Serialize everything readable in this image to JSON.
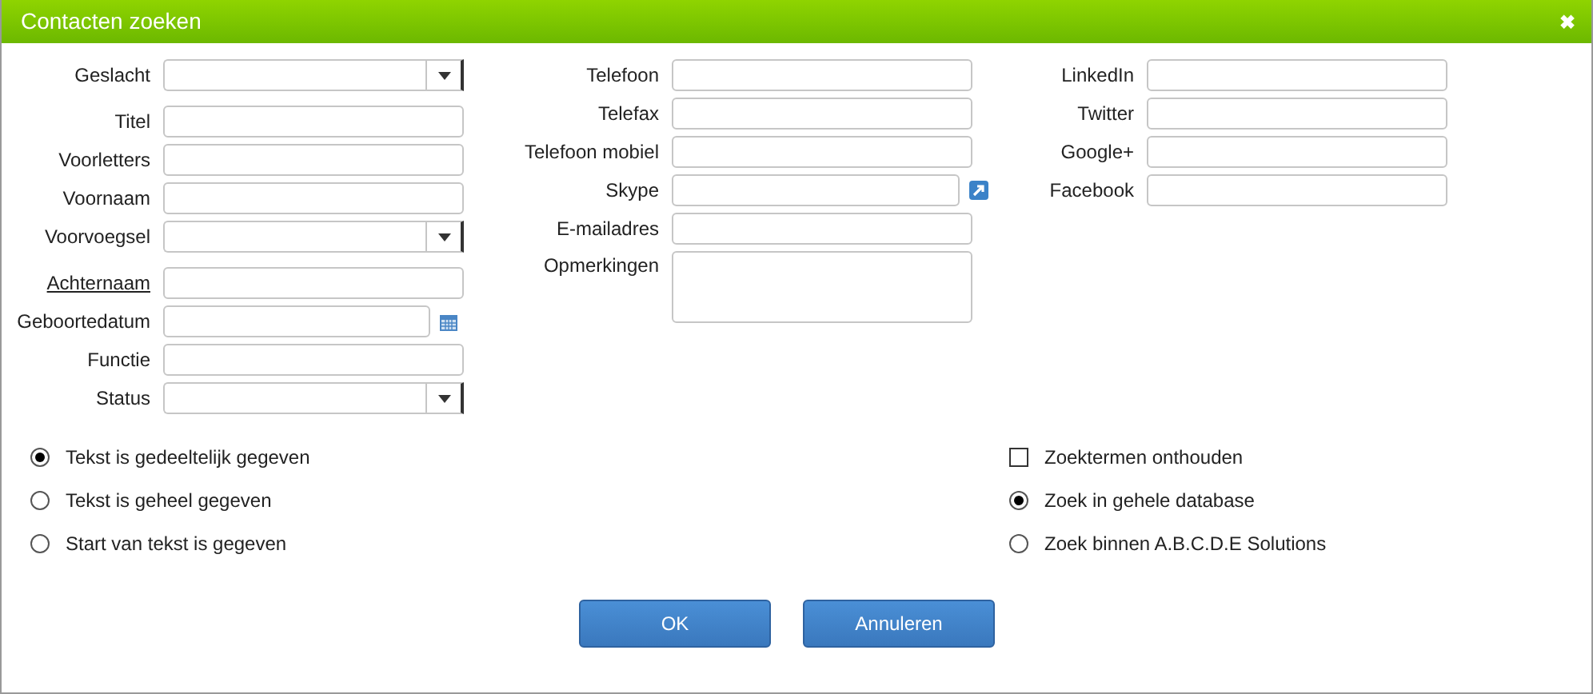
{
  "window": {
    "title": "Contacten zoeken",
    "close": "✖"
  },
  "columns": [
    {
      "fields": [
        {
          "label": "Geslacht",
          "kind": "select",
          "underlined": false
        },
        {
          "label": "Titel",
          "kind": "text",
          "underlined": false
        },
        {
          "label": "Voorletters",
          "kind": "text",
          "underlined": false
        },
        {
          "label": "Voornaam",
          "kind": "text",
          "underlined": false
        },
        {
          "label": "Voorvoegsel",
          "kind": "select",
          "underlined": false
        },
        {
          "label": "Achternaam",
          "kind": "text",
          "underlined": true
        },
        {
          "label": "Geboortedatum",
          "kind": "date",
          "underlined": false
        },
        {
          "label": "Functie",
          "kind": "text",
          "underlined": false
        },
        {
          "label": "Status",
          "kind": "select",
          "underlined": false
        }
      ]
    },
    {
      "fields": [
        {
          "label": "Telefoon",
          "kind": "text",
          "underlined": false
        },
        {
          "label": "Telefax",
          "kind": "text",
          "underlined": false
        },
        {
          "label": "Telefoon mobiel",
          "kind": "text",
          "underlined": false
        },
        {
          "label": "Skype",
          "kind": "link",
          "underlined": false
        },
        {
          "label": "E-mailadres",
          "kind": "text",
          "underlined": false
        },
        {
          "label": "Opmerkingen",
          "kind": "textarea",
          "underlined": false
        }
      ]
    },
    {
      "fields": [
        {
          "label": "LinkedIn",
          "kind": "text",
          "underlined": false
        },
        {
          "label": "Twitter",
          "kind": "text",
          "underlined": false
        },
        {
          "label": "Google+",
          "kind": "text",
          "underlined": false
        },
        {
          "label": "Facebook",
          "kind": "text",
          "underlined": false
        }
      ]
    }
  ],
  "options": [
    [
      {
        "label": "Tekst is gedeeltelijk gegeven",
        "kind": "radio",
        "checked": true
      },
      {
        "label": "Tekst is geheel gegeven",
        "kind": "radio",
        "checked": false
      },
      {
        "label": "Start van tekst is gegeven",
        "kind": "radio",
        "checked": false
      }
    ],
    [
      {
        "label": "Zoektermen onthouden",
        "kind": "checkbox",
        "checked": false
      },
      {
        "label": "Zoek in gehele database",
        "kind": "radio",
        "checked": true
      },
      {
        "label": "Zoek binnen A.B.C.D.E Solutions",
        "kind": "radio",
        "checked": false
      }
    ]
  ],
  "buttons": [
    "OK",
    "Annuleren"
  ]
}
